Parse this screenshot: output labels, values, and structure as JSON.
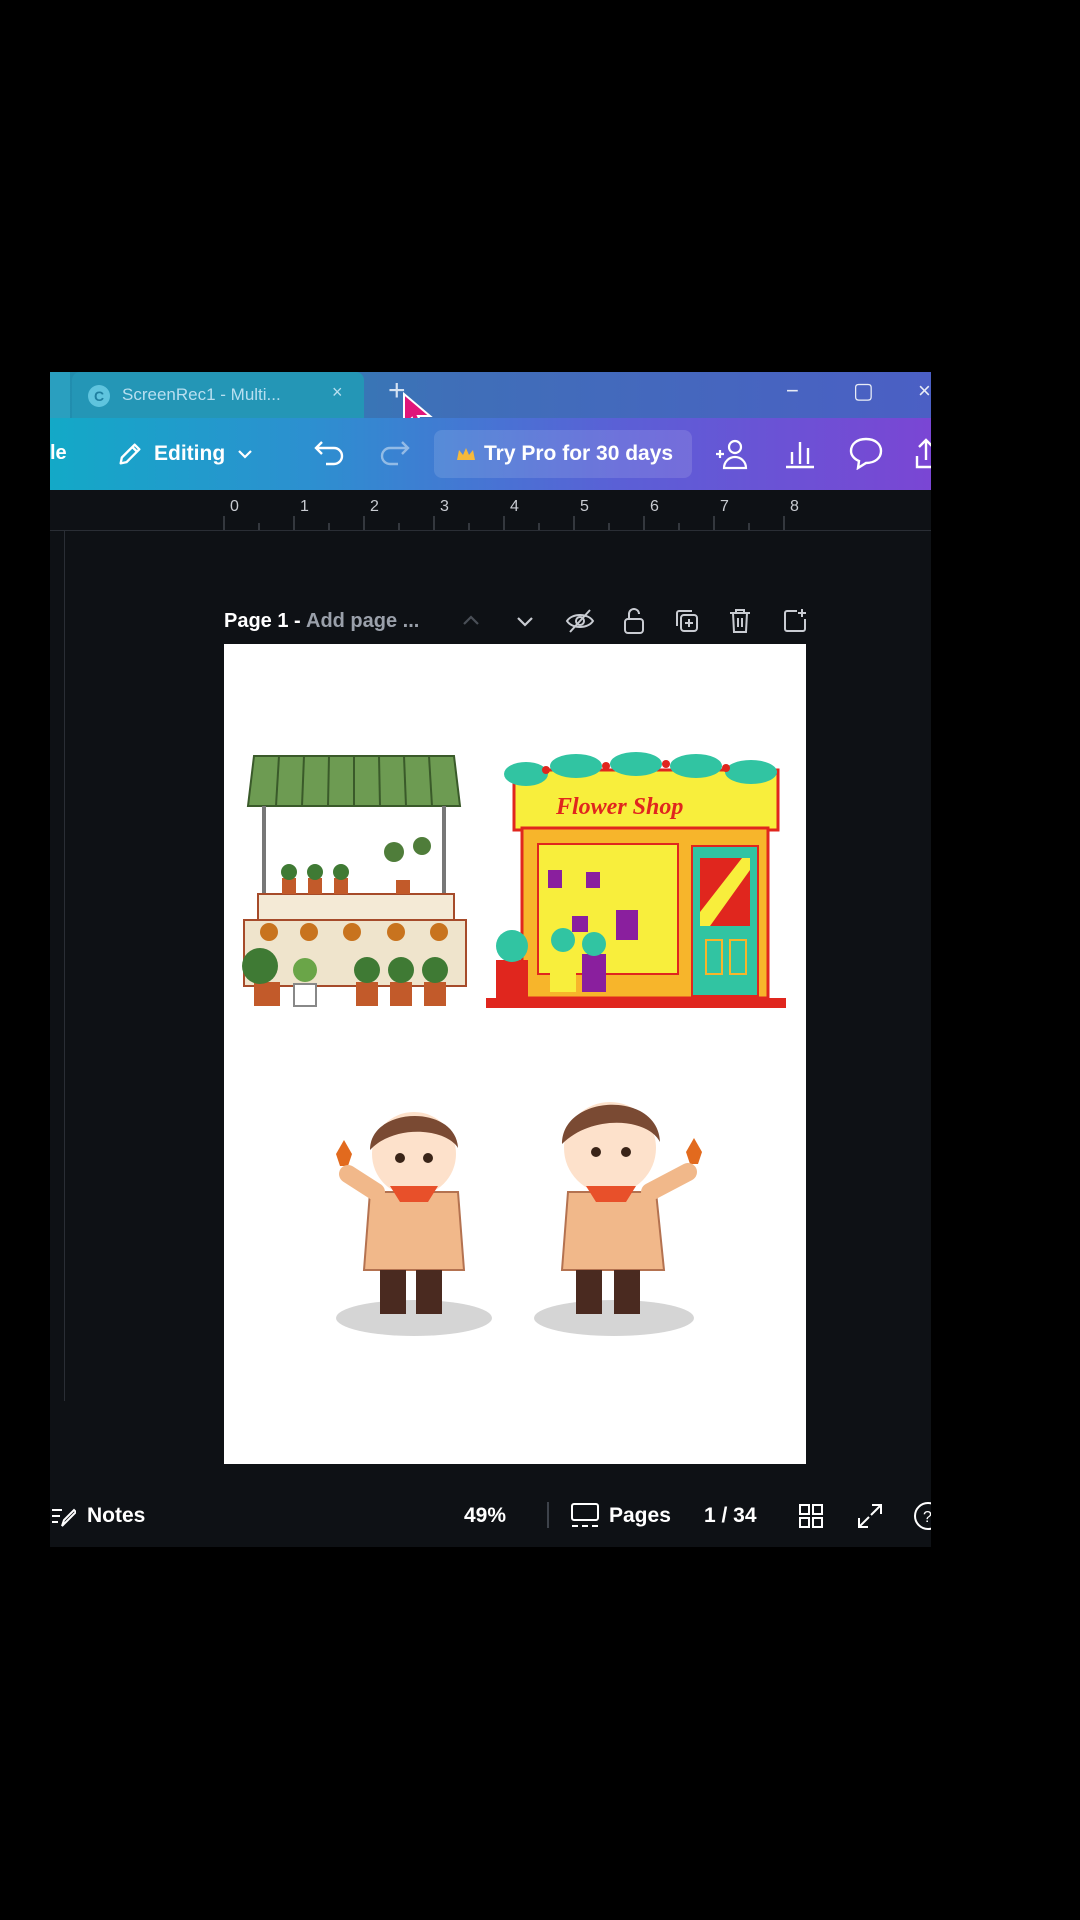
{
  "browser": {
    "tab_title": "ScreenRec1 - Multi...",
    "tab_close": "×",
    "new_tab": "+"
  },
  "window_controls": {
    "minimize": "−",
    "maximize": "▢",
    "close": "×"
  },
  "toolbar": {
    "file_label": "le",
    "editing_label": "Editing",
    "try_pro_label": "Try Pro for 30 days"
  },
  "ruler": {
    "ticks": [
      "0",
      "1",
      "2",
      "3",
      "4",
      "5",
      "6",
      "7",
      "8"
    ]
  },
  "page_header": {
    "page_label": "Page 1 -",
    "add_title_placeholder": "Add page ..."
  },
  "canvas": {
    "flower_shop_sign": "Flower Shop"
  },
  "footer": {
    "notes_label": "Notes",
    "zoom_label": "49%",
    "pages_label": "Pages",
    "page_counter": "1 / 34"
  },
  "colors": {
    "toolbar_start": "#13a9c7",
    "toolbar_end": "#7a46d4",
    "canvas_bg": "#ffffff",
    "workspace_bg": "#0e1115"
  }
}
